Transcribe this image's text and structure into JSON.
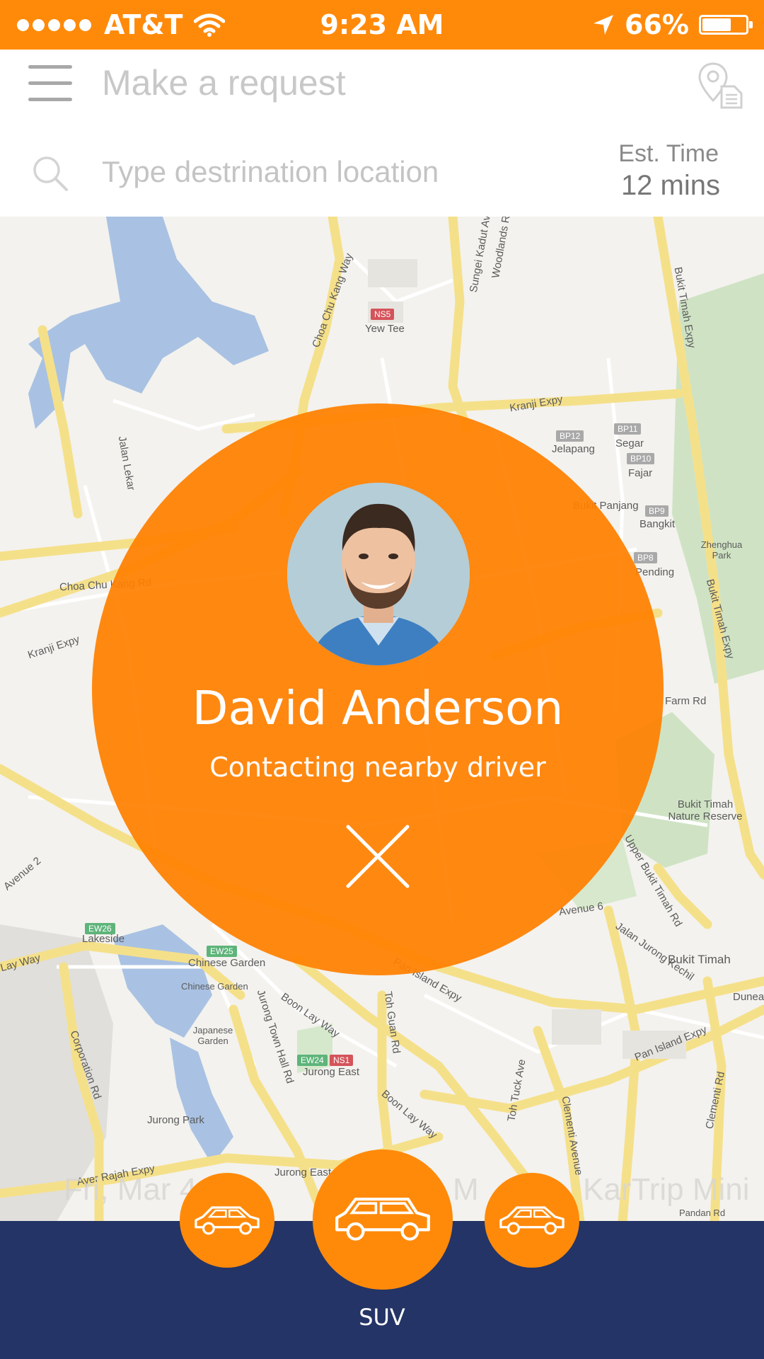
{
  "status_bar": {
    "carrier": "AT&T",
    "time": "9:23 AM",
    "battery_percent": "66%",
    "battery_level": 0.66
  },
  "header": {
    "title": "Make a request",
    "search": {
      "placeholder": "Type destrination location",
      "value": ""
    },
    "est_time": {
      "label": "Est. Time",
      "value": "12 mins"
    }
  },
  "map": {
    "labels": [
      "Yew Tee",
      "Choa Chu Kang Way",
      "Sungei Kadut Ave",
      "Woodlands Rd",
      "Bukit Timah Expy",
      "Kranji Expy",
      "Jelapang",
      "Segar",
      "Fajar",
      "Bangkit",
      "Zhenghua Park",
      "Pending",
      "Choa Chu Kang Rd",
      "Kranji Expy",
      "Bukit Timah Expy",
      "Farm Rd",
      "Bukit Timah Nature Reserve",
      "Lakeside",
      "Chinese Garden",
      "Chinese Garden",
      "Japanese Garden",
      "Jurong Town Hall Rd",
      "Boon Lay Way",
      "Toh Guan Rd",
      "Jurong East",
      "Boon Lay Way",
      "Toh Tuck Ave",
      "Clementi Avenue",
      "Pan Island Expy",
      "Pan Island Expy",
      "Upper Bukit Timah Rd",
      "Jalan Jurong Kechil",
      "Bukit Timah",
      "Dunearn",
      "Clementi Rd",
      "Corporation Rd",
      "Jurong Park",
      "Ayer Rajah Expy",
      "Jurong East",
      "Pandan Rd",
      "Avenue 6",
      "Jalan Lekar",
      "Avenue 2",
      "Lay Way",
      "Bukit Panjang"
    ],
    "badges": [
      "NS5",
      "BP12",
      "BP11",
      "BP10",
      "BP9",
      "BP8",
      "EW26",
      "EW25",
      "EW24",
      "NS1"
    ]
  },
  "carousel": {
    "left_text": "Fri, Mar 4",
    "mid_text": "M",
    "right_text": "KarTrip Mini"
  },
  "request": {
    "driver_name": "David Anderson",
    "status": "Contacting nearby driver"
  },
  "vehicle": {
    "selected_label": "SUV"
  },
  "colors": {
    "orange": "#ff8a0a",
    "navy": "#243466",
    "road": "#f5e08a"
  }
}
